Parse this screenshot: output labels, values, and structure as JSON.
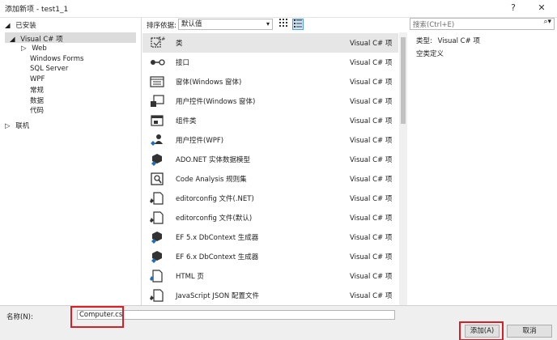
{
  "window": {
    "title": "添加新项 - test1_1",
    "help_label": "?",
    "close_label": "✕"
  },
  "left": {
    "installed_label": "已安装",
    "selected_node": "Visual C# 项",
    "children": [
      "Web",
      "Windows Forms",
      "SQL Server",
      "WPF",
      "常规",
      "数据",
      "代码"
    ],
    "online_label": "联机"
  },
  "toolbar": {
    "sort_label": "排序依据:",
    "sort_value": "默认值",
    "grid_icon": "grid-view-icon",
    "list_icon": "list-view-icon"
  },
  "search": {
    "placeholder": "搜索(Ctrl+E)"
  },
  "items": [
    {
      "name": "类",
      "type": "Visual C# 项",
      "icon": "class-icon"
    },
    {
      "name": "接口",
      "type": "Visual C# 项",
      "icon": "interface-icon"
    },
    {
      "name": "窗体(Windows 窗体)",
      "type": "Visual C# 项",
      "icon": "form-icon"
    },
    {
      "name": "用户控件(Windows 窗体)",
      "type": "Visual C# 项",
      "icon": "user-control-icon"
    },
    {
      "name": "组件类",
      "type": "Visual C# 项",
      "icon": "component-icon"
    },
    {
      "name": "用户控件(WPF)",
      "type": "Visual C# 项",
      "icon": "wpf-user-control-icon"
    },
    {
      "name": "ADO.NET 实体数据模型",
      "type": "Visual C# 项",
      "icon": "ado-net-icon"
    },
    {
      "name": "Code Analysis 规则集",
      "type": "Visual C# 项",
      "icon": "code-analysis-icon"
    },
    {
      "name": "editorconfig 文件(.NET)",
      "type": "Visual C# 项",
      "icon": "editorconfig-icon"
    },
    {
      "name": "editorconfig 文件(默认)",
      "type": "Visual C# 项",
      "icon": "editorconfig-icon"
    },
    {
      "name": "EF 5.x DbContext 生成器",
      "type": "Visual C# 项",
      "icon": "ef-icon"
    },
    {
      "name": "EF 6.x DbContext 生成器",
      "type": "Visual C# 项",
      "icon": "ef-icon"
    },
    {
      "name": "HTML 页",
      "type": "Visual C# 项",
      "icon": "html-icon"
    },
    {
      "name": "JavaScript JSON 配置文件",
      "type": "Visual C# 项",
      "icon": "json-icon"
    }
  ],
  "details": {
    "type_label": "类型:",
    "type_value": "Visual C# 项",
    "description": "空类定义"
  },
  "name_field": {
    "label": "名称(N):",
    "value": "Computer.cs"
  },
  "buttons": {
    "add": "添加(A)",
    "cancel": "取消"
  },
  "colors": {
    "highlight": "#d91f26",
    "selected_row": "#e6e6e6"
  }
}
